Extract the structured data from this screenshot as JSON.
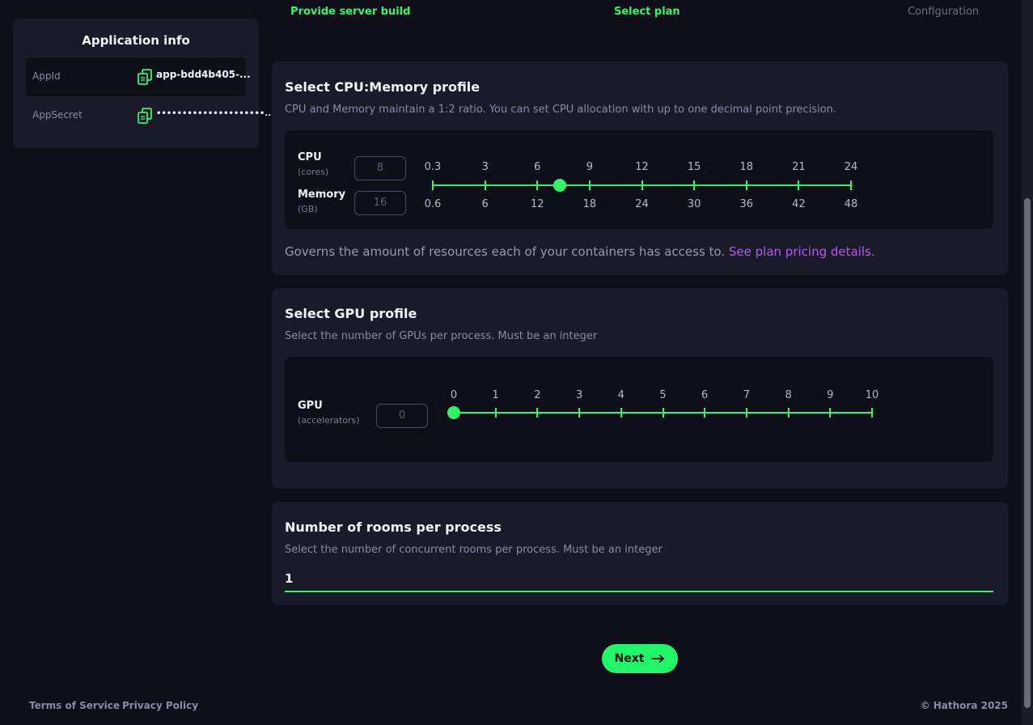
{
  "steps": [
    {
      "label": "Provide server build",
      "state": "done"
    },
    {
      "label": "Select plan",
      "state": "active"
    },
    {
      "label": "Configuration",
      "state": "pending"
    }
  ],
  "app_info": {
    "title": "Application info",
    "app_id_label": "AppId",
    "app_id_value": "app-bdd4b405-...",
    "app_secret_label": "AppSecret",
    "app_secret_value": "•••••••••••••••••••••..."
  },
  "cpu_card": {
    "title": "Select CPU:Memory profile",
    "subtitle": "CPU and Memory maintain a 1:2 ratio. You can set CPU allocation with up to one decimal point precision.",
    "cpu_label": "CPU",
    "cpu_unit": "(cores)",
    "cpu_placeholder": "8",
    "memory_label": "Memory",
    "memory_unit": "(GB)",
    "memory_placeholder": "16",
    "cpu_ticks": [
      "0.3",
      "3",
      "6",
      "9",
      "12",
      "15",
      "18",
      "21",
      "24"
    ],
    "memory_ticks": [
      "0.6",
      "6",
      "12",
      "18",
      "24",
      "30",
      "36",
      "42",
      "48"
    ],
    "slider_value_cores": 7.3,
    "governs_text": "Governs the amount of resources each of your containers has access to.",
    "pricing_link": "See plan pricing details."
  },
  "gpu_card": {
    "title": "Select GPU profile",
    "subtitle": "Select the number of GPUs per process. Must be an integer",
    "gpu_label": "GPU",
    "gpu_unit": "(accelerators)",
    "gpu_placeholder": "0",
    "gpu_ticks": [
      "0",
      "1",
      "2",
      "3",
      "4",
      "5",
      "6",
      "7",
      "8",
      "9",
      "10"
    ],
    "slider_value": 0
  },
  "rooms_card": {
    "title": "Number of rooms per process",
    "subtitle": "Select the number of concurrent rooms per process. Must be an integer",
    "value": "1"
  },
  "next_button": {
    "label": "Next",
    "icon": "arrow-right-icon"
  },
  "footer": {
    "terms": "Terms of Service",
    "privacy": "Privacy Policy",
    "copyright": "© Hathora 2025"
  },
  "colors": {
    "accent": "#2ef56a",
    "link": "#b05cf5",
    "background": "#0f0f1a",
    "card": "#1a1a29"
  }
}
